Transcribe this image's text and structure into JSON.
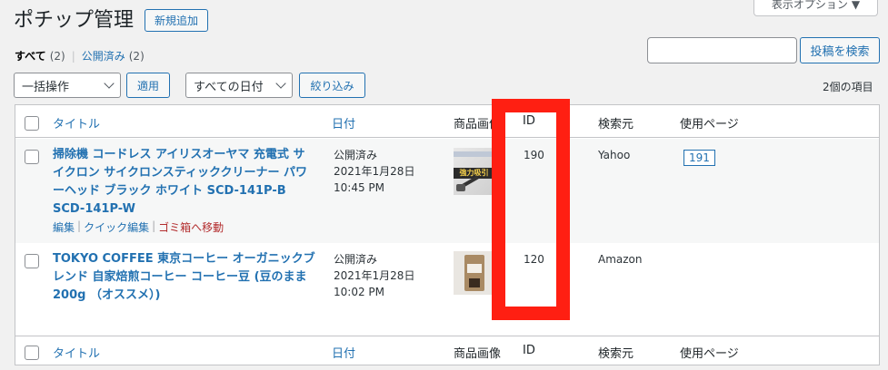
{
  "header": {
    "title": "ポチップ管理",
    "add_new": "新規追加",
    "screen_options": "表示オプション"
  },
  "filters": {
    "all_label": "すべて",
    "all_count": "(2)",
    "published_label": "公開済み",
    "published_count": "(2)",
    "separator": "|"
  },
  "search": {
    "value": "",
    "button": "投稿を検索"
  },
  "bulk": {
    "action": "一括操作",
    "apply": "適用",
    "dates": "すべての日付",
    "filter": "絞り込み"
  },
  "item_count": "2個の項目",
  "columns": {
    "title": "タイトル",
    "date": "日付",
    "image": "商品画像",
    "id": "ID",
    "source": "検索元",
    "used_page": "使用ページ"
  },
  "rows": [
    {
      "title": "掃除機 コードレス アイリスオーヤマ 充電式 サイクロン サイクロンスティッククリーナー パワーヘッド ブラック ホワイト SCD-141P-B SCD-141P-W",
      "status": "公開済み",
      "date": "2021年1月28日",
      "time": "10:45 PM",
      "id": "190",
      "source": "Yahoo",
      "page": "191",
      "actions": {
        "edit": "編集",
        "quick_edit": "クイック編集",
        "trash": "ゴミ箱へ移動",
        "sep": "|"
      },
      "thumb_text": "強力吸引"
    },
    {
      "title": "TOKYO COFFEE 東京コーヒー オーガニックブレンド 自家焙煎コーヒー コーヒー豆 (豆のまま 200g （オススメ）)",
      "status": "公開済み",
      "date": "2021年1月28日",
      "time": "10:02 PM",
      "id": "120",
      "source": "Amazon",
      "page": ""
    }
  ],
  "colors": {
    "link": "#2271b1",
    "highlight": "#ff1f12",
    "trash": "#b32d2e"
  }
}
